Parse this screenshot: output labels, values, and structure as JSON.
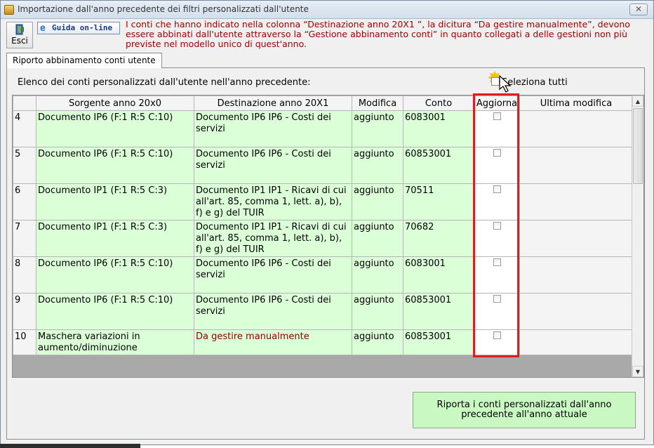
{
  "window": {
    "title": "Importazione dall'anno precedente dei filtri personalizzati dall'utente",
    "close_label": "✕"
  },
  "toolbar": {
    "esci_label": "Esci",
    "guida_label": "Guida on-line",
    "notice": "I conti che hanno indicato nella colonna “Destinazione anno 20X1 ”, la dicitura “Da gestire manualmente”, devono essere abbinati dall'utente attraverso la “Gestione abbinamento conti” in quanto collegati a delle gestioni non più previste nel modello unico di quest'anno."
  },
  "tab": {
    "label": "Riporto abbinamento conti utente"
  },
  "panel": {
    "list_label": "Elenco dei conti personalizzati dall'utente nell'anno precedente:",
    "select_all_label": "Seleziona tutti"
  },
  "table": {
    "headers": [
      "",
      "Sorgente anno 20x0",
      "Destinazione anno 20X1",
      "Modifica",
      "Conto",
      "Aggiorna",
      "Ultima modifica"
    ],
    "rows": [
      {
        "n": "4",
        "source": "Documento IP6 (F:1 R:5 C:10)",
        "dest": "Documento IP6 IP6 - Costi dei servizi",
        "mod": "aggiunto",
        "conto": "6083001",
        "ultima": ""
      },
      {
        "n": "5",
        "source": "Documento IP6 (F:1 R:5 C:10)",
        "dest": "Documento IP6 IP6 - Costi dei servizi",
        "mod": "aggiunto",
        "conto": "60853001",
        "ultima": ""
      },
      {
        "n": "6",
        "source": "Documento IP1 (F:1 R:5 C:3)",
        "dest": "Documento IP1 IP1 - Ricavi di cui all'art. 85, comma 1, lett. a), b), f) e g) del TUIR",
        "mod": "aggiunto",
        "conto": "70511",
        "ultima": ""
      },
      {
        "n": "7",
        "source": "Documento IP1 (F:1 R:5 C:3)",
        "dest": "Documento IP1 IP1 - Ricavi di cui all'art. 85, comma 1, lett. a), b), f) e g) del TUIR",
        "mod": "aggiunto",
        "conto": "70682",
        "ultima": ""
      },
      {
        "n": "8",
        "source": "Documento IP6 (F:1 R:5 C:10)",
        "dest": "Documento IP6 IP6 - Costi dei servizi",
        "mod": "aggiunto",
        "conto": "6083001",
        "ultima": ""
      },
      {
        "n": "9",
        "source": "Documento IP6 (F:1 R:5 C:10)",
        "dest": "Documento IP6 IP6 - Costi dei servizi",
        "mod": "aggiunto",
        "conto": "60853001",
        "ultima": ""
      },
      {
        "n": "10",
        "source": "Maschera variazioni in aumento/diminuzione",
        "dest": "Da gestire manualmente",
        "mod": "aggiunto",
        "conto": "60853001",
        "ultima": ""
      }
    ]
  },
  "actions": {
    "report_button": "Riporta i conti personalizzati dall'anno precedente all'anno attuale"
  },
  "colors": {
    "green_cell": "#dbffd7",
    "notice_text": "#a10000",
    "highlight": "#e21c1c",
    "button_green": "#c9f8c3"
  }
}
